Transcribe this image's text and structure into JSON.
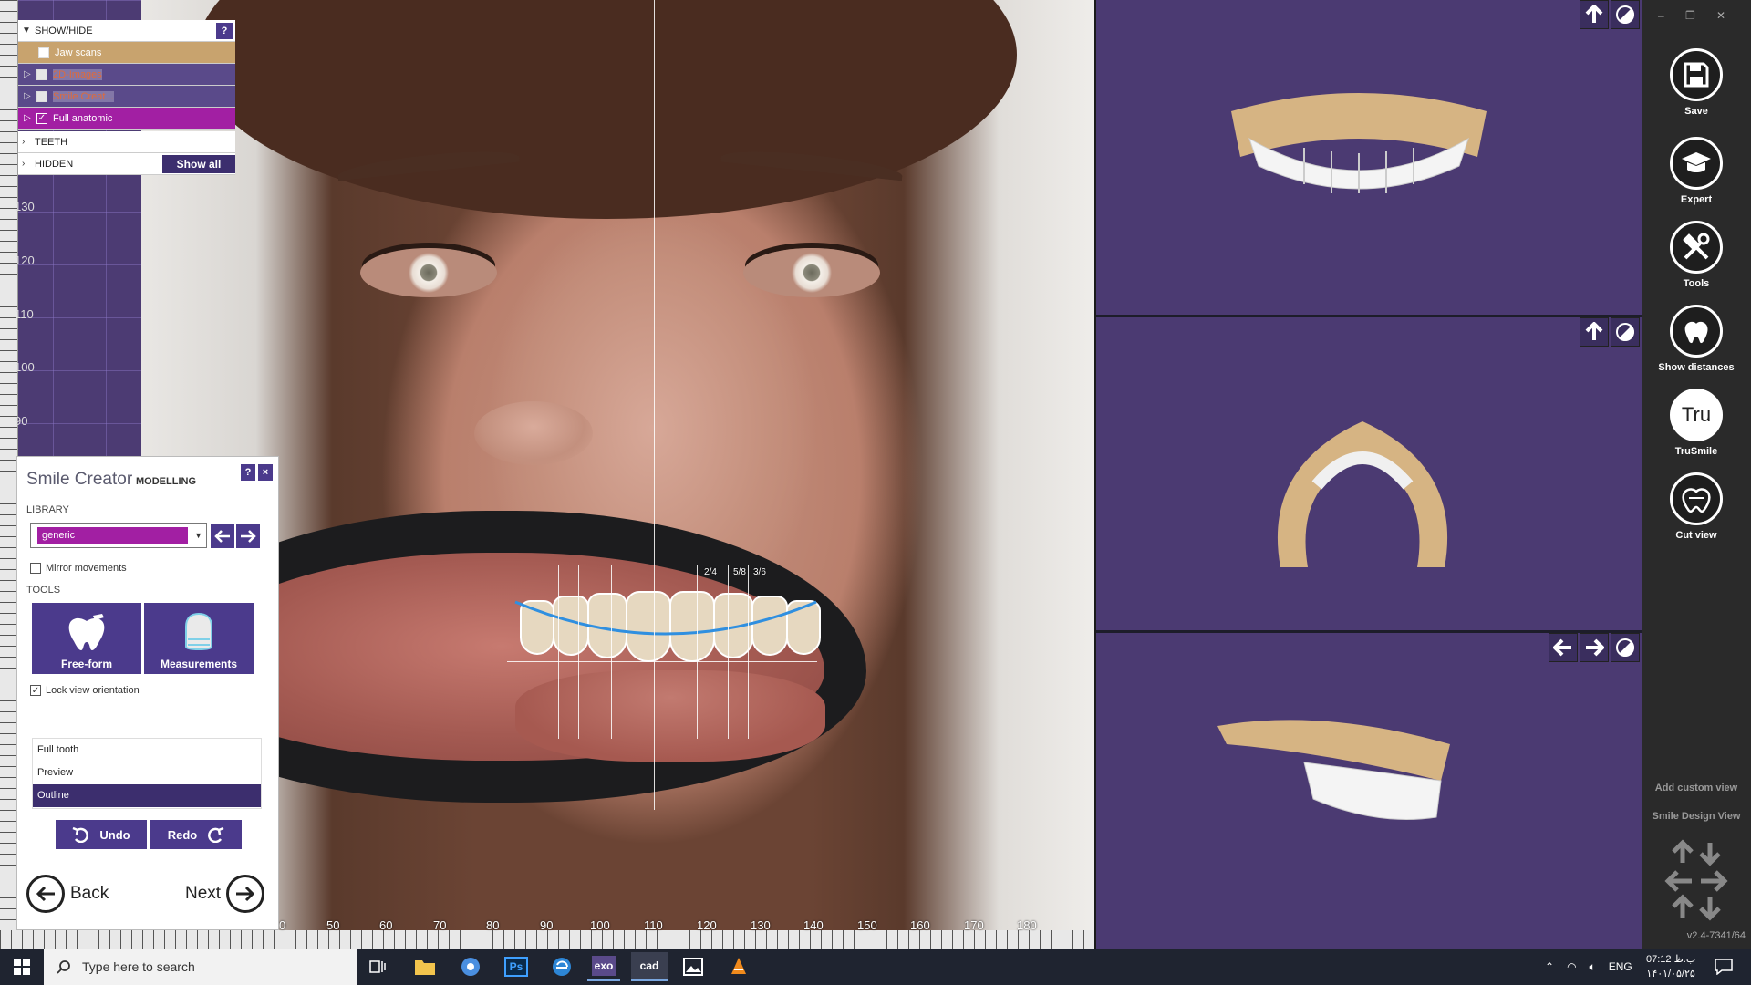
{
  "showhide": {
    "header": "SHOW/HIDE",
    "help": "?",
    "jaw_scans": "Jaw scans",
    "images_2d": "2D-Images",
    "smile_creator": "Smile Creat...",
    "full_anatomic": "Full anatomic",
    "teeth": "TEETH",
    "hidden": "HIDDEN",
    "show_all": "Show all"
  },
  "rulers": {
    "left": [
      "130",
      "120",
      "110",
      "100",
      "90"
    ],
    "bottom": [
      "0",
      "50",
      "60",
      "70",
      "80",
      "90",
      "100",
      "110",
      "120",
      "130",
      "140",
      "150",
      "160",
      "170",
      "180"
    ]
  },
  "tooth_labels": [
    "2/4",
    "5/8",
    "3/6"
  ],
  "smile_creator": {
    "title": "Smile Creator",
    "subtitle": "MODELLING",
    "help": "?",
    "close": "×",
    "library_label": "LIBRARY",
    "library_value": "generic",
    "mirror": "Mirror movements",
    "tools_label": "TOOLS",
    "freeform": "Free-form",
    "measurements": "Measurements",
    "lock": "Lock view orientation",
    "modes": [
      "Full tooth",
      "Preview",
      "Outline"
    ],
    "undo": "Undo",
    "redo": "Redo",
    "back": "Back",
    "next": "Next"
  },
  "sidebar": {
    "save": "Save",
    "expert": "Expert",
    "tools": "Tools",
    "show_distances": "Show distances",
    "trusmile": "TruSmile",
    "trusmile_icon_text": "Tru",
    "cut_view": "Cut view",
    "add_custom_view": "Add custom view",
    "smile_design_view": "Smile Design View",
    "version": "v2.4-7341/64"
  },
  "taskbar": {
    "search_placeholder": "Type here to search",
    "apps": [
      "Ps",
      "exo",
      "cad"
    ],
    "lang": "ENG",
    "time": "07:12 ب.ظ",
    "date": "۱۴۰۱/۰۵/۲۵"
  },
  "colors": {
    "accent": "#4b3a8c",
    "highlight": "#a21fa3",
    "viewport_bg": "#4b3a72"
  }
}
